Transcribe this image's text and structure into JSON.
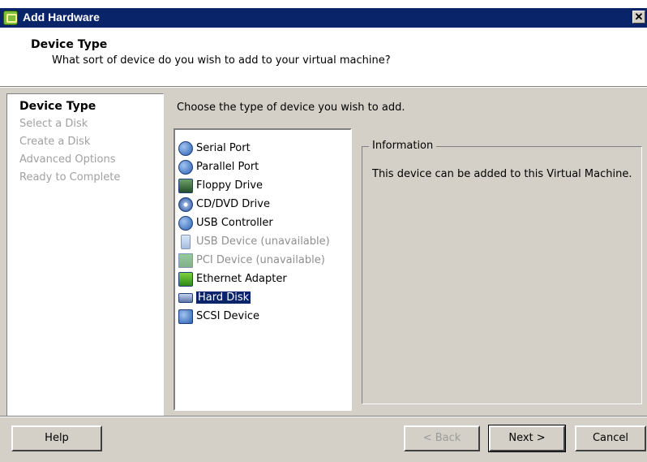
{
  "window": {
    "title": "Add Hardware",
    "close_glyph": "✕"
  },
  "header": {
    "title": "Device Type",
    "subtitle": "What sort of device do you wish to add to your virtual machine?"
  },
  "steps": [
    {
      "label": "Device Type",
      "state": "current"
    },
    {
      "label": "Select a Disk",
      "state": "disabled"
    },
    {
      "label": "Create a Disk",
      "state": "disabled"
    },
    {
      "label": "Advanced Options",
      "state": "disabled"
    },
    {
      "label": "Ready to Complete",
      "state": "disabled"
    }
  ],
  "main": {
    "prompt": "Choose the type of device you wish to add.",
    "devices": [
      {
        "label": "Serial Port",
        "icon": "serial-port-icon",
        "state": "enabled"
      },
      {
        "label": "Parallel Port",
        "icon": "parallel-port-icon",
        "state": "enabled"
      },
      {
        "label": "Floppy Drive",
        "icon": "floppy-drive-icon",
        "state": "enabled"
      },
      {
        "label": "CD/DVD Drive",
        "icon": "cd-dvd-drive-icon",
        "state": "enabled"
      },
      {
        "label": "USB Controller",
        "icon": "usb-controller-icon",
        "state": "enabled"
      },
      {
        "label": "USB Device (unavailable)",
        "icon": "usb-device-icon",
        "state": "disabled"
      },
      {
        "label": "PCI Device (unavailable)",
        "icon": "pci-device-icon",
        "state": "disabled"
      },
      {
        "label": "Ethernet Adapter",
        "icon": "ethernet-adapter-icon",
        "state": "enabled"
      },
      {
        "label": "Hard Disk",
        "icon": "hard-disk-icon",
        "state": "selected"
      },
      {
        "label": "SCSI Device",
        "icon": "scsi-device-icon",
        "state": "enabled"
      }
    ],
    "information": {
      "legend": "Information",
      "text": "This device can be added to this Virtual Machine."
    }
  },
  "footer": {
    "help_label": "Help",
    "back_label": "< Back",
    "next_label": "Next >",
    "cancel_label": "Cancel"
  },
  "colors": {
    "titlebar": "#0a246a",
    "dialog_face": "#d4d0c8",
    "selection": "#0a246a",
    "disabled_text": "#a0a0a0"
  }
}
